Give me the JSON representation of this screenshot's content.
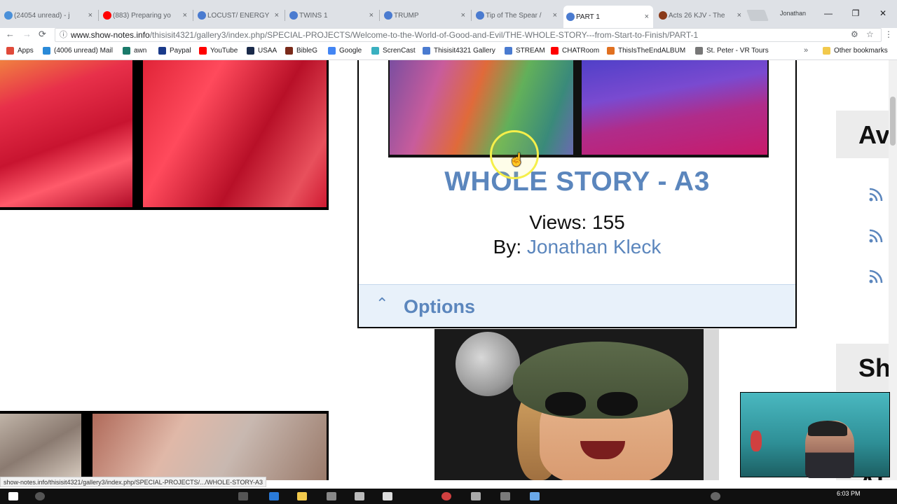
{
  "browser": {
    "tabs": [
      {
        "label": "(24054 unread) - j",
        "color": "#4a90d9"
      },
      {
        "label": "(883) Preparing yo",
        "color": "#ff0000"
      },
      {
        "label": "LOCUST/ ENERGY",
        "color": "#4a7bd0"
      },
      {
        "label": "TWINS 1",
        "color": "#4a7bd0"
      },
      {
        "label": "TRUMP",
        "color": "#4a7bd0"
      },
      {
        "label": "Tip of The Spear /",
        "color": "#4a7bd0"
      },
      {
        "label": "PART 1",
        "color": "#4a7bd0"
      },
      {
        "label": "Acts 26 KJV - The",
        "color": "#8a3a1a"
      }
    ],
    "tab_close": "×",
    "profile_name": "Jonathan",
    "window_buttons": {
      "minimize": "—",
      "maximize": "❐",
      "close": "✕"
    },
    "nav": {
      "back": "←",
      "forward": "→",
      "reload": "⟳"
    },
    "address": {
      "host": "www.show-notes.info",
      "path": "/thisisit4321/gallery3/index.php/SPECIAL-PROJECTS/Welcome-to-the-World-of-Good-and-Evil/THE-WHOLE-STORY---from-Start-to-Finish/PART-1"
    },
    "bookmarks": [
      {
        "label": "Apps",
        "color": "#e04a3a"
      },
      {
        "label": "(4006 unread) Mail",
        "color": "#2a8ad8"
      },
      {
        "label": "awn",
        "color": "#1a7a6a"
      },
      {
        "label": "Paypal",
        "color": "#1a3a8a"
      },
      {
        "label": "YouTube",
        "color": "#ff0000"
      },
      {
        "label": "USAA",
        "color": "#1a2a4a"
      },
      {
        "label": "BibleG",
        "color": "#7a2a1a"
      },
      {
        "label": "Google",
        "color": "#4285f4"
      },
      {
        "label": "ScrenCast",
        "color": "#3ab0c0"
      },
      {
        "label": "Thisisit4321 Gallery",
        "color": "#4a7bd0"
      },
      {
        "label": "STREAM",
        "color": "#4a7bd0"
      },
      {
        "label": "CHATRoom",
        "color": "#ff0000"
      },
      {
        "label": "ThisIsTheEndALBUM",
        "color": "#e07020"
      },
      {
        "label": "St. Peter - VR Tours",
        "color": "#777777"
      }
    ],
    "bookmarks_more": "»",
    "other_bookmarks": "Other bookmarks"
  },
  "card": {
    "title": "WHOLE STORY - A3",
    "views": "Views: 155",
    "by_label": "By:",
    "author": "Jonathan Kleck",
    "options_chevron": "⌃",
    "options_label": "Options"
  },
  "sidebar": {
    "box1_title": "Av",
    "box2_title": "Sh",
    "box3_title": "Al"
  },
  "cursor_icon": "hand-pointer-icon",
  "status_url": "show-notes.info/thisisit4321/gallery3/index.php/SPECIAL-PROJECTS/.../WHOLE-STORY-A3",
  "taskbar": {
    "time": "6:03 PM"
  }
}
